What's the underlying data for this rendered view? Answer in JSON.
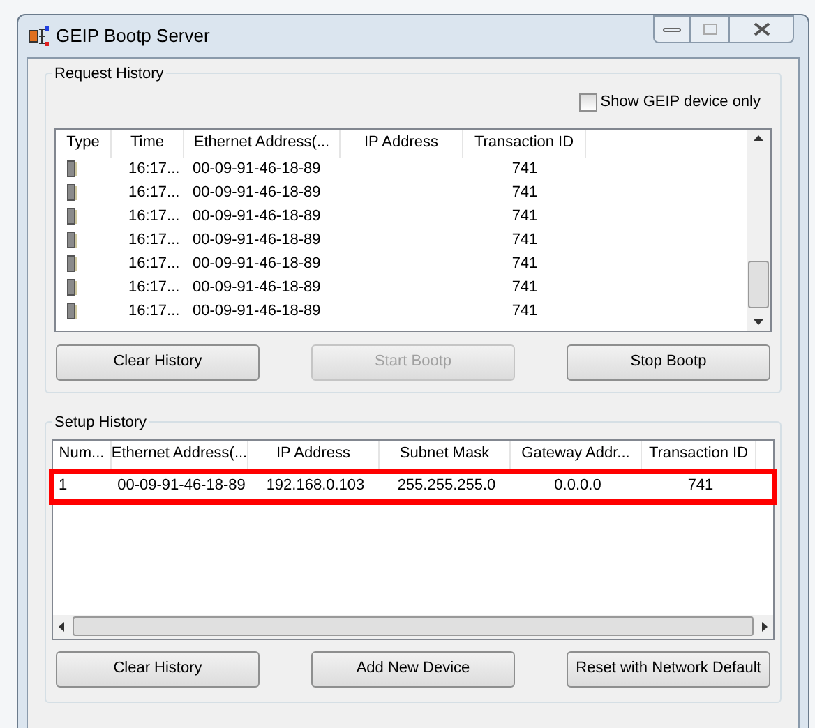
{
  "window": {
    "title": "GEIP Bootp Server"
  },
  "request_history": {
    "title": "Request History",
    "show_geip_only": {
      "label": "Show GEIP device only",
      "checked": false
    },
    "columns": [
      "Type",
      "Time",
      "Ethernet Address(...",
      "IP Address",
      "Transaction ID"
    ],
    "rows": [
      {
        "time": "16:17...",
        "ethernet": "00-09-91-46-18-89",
        "ip": "",
        "transaction_id": "741"
      },
      {
        "time": "16:17...",
        "ethernet": "00-09-91-46-18-89",
        "ip": "",
        "transaction_id": "741"
      },
      {
        "time": "16:17...",
        "ethernet": "00-09-91-46-18-89",
        "ip": "",
        "transaction_id": "741"
      },
      {
        "time": "16:17...",
        "ethernet": "00-09-91-46-18-89",
        "ip": "",
        "transaction_id": "741"
      },
      {
        "time": "16:17...",
        "ethernet": "00-09-91-46-18-89",
        "ip": "",
        "transaction_id": "741"
      },
      {
        "time": "16:17...",
        "ethernet": "00-09-91-46-18-89",
        "ip": "",
        "transaction_id": "741"
      },
      {
        "time": "16:17...",
        "ethernet": "00-09-91-46-18-89",
        "ip": "",
        "transaction_id": "741"
      }
    ],
    "buttons": [
      {
        "label": "Clear History",
        "disabled": false
      },
      {
        "label": "Start Bootp",
        "disabled": true
      },
      {
        "label": "Stop Bootp",
        "disabled": false
      }
    ]
  },
  "setup_history": {
    "title": "Setup History",
    "columns": [
      "Num...",
      "Ethernet Address(...",
      "IP Address",
      "Subnet Mask",
      "Gateway Addr...",
      "Transaction ID"
    ],
    "rows": [
      {
        "highlighted": true,
        "cells": [
          "1",
          "00-09-91-46-18-89",
          "192.168.0.103",
          "255.255.255.0",
          "0.0.0.0",
          "741"
        ]
      }
    ],
    "buttons": [
      {
        "label": "Clear History",
        "disabled": false
      },
      {
        "label": "Add New Device",
        "disabled": false
      },
      {
        "label": "Reset with Network Default",
        "disabled": false
      }
    ]
  }
}
